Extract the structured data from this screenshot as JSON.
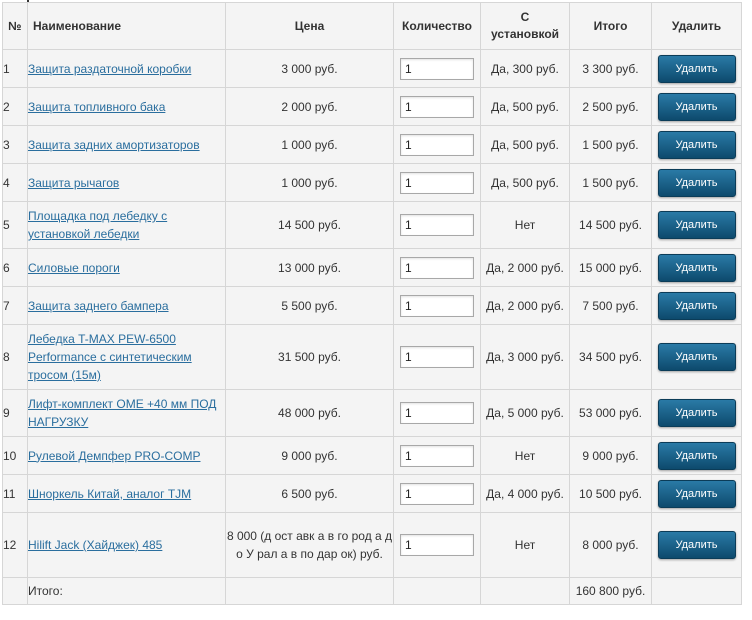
{
  "headers": {
    "num": "№",
    "name": "Наименование",
    "price": "Цена",
    "qty": "Количество",
    "install_line1": "С",
    "install_line2": "установкой",
    "total": "Итого",
    "delete": "Удалить"
  },
  "delete_label": "Удалить",
  "rows": [
    {
      "num": "1",
      "name": "Защита раздаточной коробки",
      "price": "3 000 руб.",
      "qty": "1",
      "install": "Да, 300 руб.",
      "total": "3 300 руб."
    },
    {
      "num": "2",
      "name": "Защита топливного бака",
      "price": "2 000 руб.",
      "qty": "1",
      "install": "Да, 500 руб.",
      "total": "2 500 руб."
    },
    {
      "num": "3",
      "name": "Защита задних амортизаторов",
      "price": "1 000 руб.",
      "qty": "1",
      "install": "Да, 500 руб.",
      "total": "1 500 руб."
    },
    {
      "num": "4",
      "name": "Защита рычагов",
      "price": "1 000 руб.",
      "qty": "1",
      "install": "Да, 500 руб.",
      "total": "1 500 руб."
    },
    {
      "num": "5",
      "name": "Площадка под лебедку с установкой лебедки",
      "price": "14 500 руб.",
      "qty": "1",
      "install": "Нет",
      "total": "14 500 руб."
    },
    {
      "num": "6",
      "name": "Силовые пороги",
      "price": "13 000 руб.",
      "qty": "1",
      "install": "Да, 2 000 руб.",
      "total": "15 000 руб."
    },
    {
      "num": "7",
      "name": "Защита заднего бампера",
      "price": "5 500 руб.",
      "qty": "1",
      "install": "Да, 2 000 руб.",
      "total": "7 500 руб."
    },
    {
      "num": "8",
      "name": "Лебедка T-MAX PEW-6500 Performance с синтетическим тросом (15м)",
      "price": "31 500 руб.",
      "qty": "1",
      "install": "Да, 3 000 руб.",
      "total": "34 500 руб."
    },
    {
      "num": "9",
      "name": "Лифт-комплект OME +40 мм ПОД НАГРУЗКУ",
      "price": "48 000 руб.",
      "qty": "1",
      "install": "Да, 5 000 руб.",
      "total": "53 000 руб."
    },
    {
      "num": "10",
      "name": "Рулевой Демпфер PRO-COMP",
      "price": "9 000 руб.",
      "qty": "1",
      "install": "Нет",
      "total": "9 000 руб."
    },
    {
      "num": "11",
      "name": "Шноркель Китай, аналог TJM",
      "price": "6 500 руб.",
      "qty": "1",
      "install": "Да, 4 000 руб.",
      "total": "10 500 руб."
    },
    {
      "num": "12",
      "name": "Hilift Jack (Хайджек) 485",
      "price": "8 000  (д ост авк а в го род а д о У рал а в по дар ок) руб.",
      "qty": "1",
      "install": "Нет",
      "total": "8 000 руб."
    }
  ],
  "footer": {
    "label": "Итого:",
    "sum": "160 800 руб."
  }
}
